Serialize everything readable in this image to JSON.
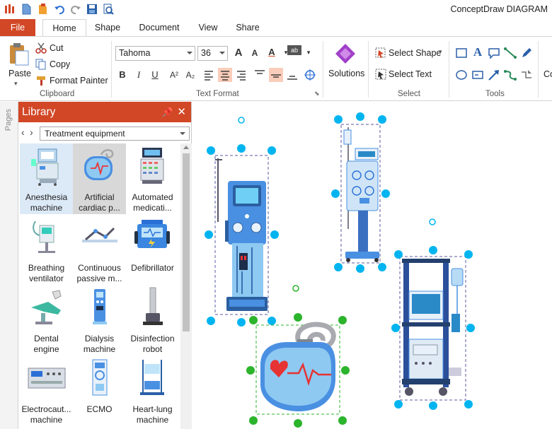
{
  "app": {
    "title": "ConceptDraw DIAGRAM"
  },
  "ribbon_tabs": [
    {
      "label": "File"
    },
    {
      "label": "Home"
    },
    {
      "label": "Shape"
    },
    {
      "label": "Document"
    },
    {
      "label": "View"
    },
    {
      "label": "Share"
    }
  ],
  "clipboard": {
    "paste": "Paste",
    "cut": "Cut",
    "copy": "Copy",
    "format_painter": "Format Painter",
    "group_label": "Clipboard"
  },
  "text_format": {
    "font": "Tahoma",
    "size": "36",
    "group_label": "Text Format"
  },
  "solutions": {
    "label": "Solutions"
  },
  "select": {
    "select_shape": "Select Shape",
    "select_text": "Select Text",
    "group_label": "Select"
  },
  "tools": {
    "group_label": "Tools",
    "cut_off": "Co"
  },
  "sidebar": {
    "pages_label": "Pages"
  },
  "library": {
    "title": "Library",
    "selected_library": "Treatment equipment",
    "items": [
      {
        "line1": "Anesthesia",
        "line2": "machine"
      },
      {
        "line1": "Artificial",
        "line2": "cardiac p..."
      },
      {
        "line1": "Automated",
        "line2": "medicati..."
      },
      {
        "line1": "Breathing",
        "line2": "ventilator"
      },
      {
        "line1": "Continuous",
        "line2": "passive m..."
      },
      {
        "line1": "Defibrillator",
        "line2": ""
      },
      {
        "line1": "Dental",
        "line2": "engine"
      },
      {
        "line1": "Dialysis",
        "line2": "machine"
      },
      {
        "line1": "Disinfection",
        "line2": "robot"
      },
      {
        "line1": "Electrocaut...",
        "line2": "machine"
      },
      {
        "line1": "ECMO",
        "line2": ""
      },
      {
        "line1": "Heart-lung",
        "line2": "machine"
      }
    ]
  },
  "colors": {
    "accent": "#d24726",
    "handle": "#00b4f0",
    "handle_selected": "#2cb42c",
    "device_blue": "#4a90e2",
    "device_light": "#8ec9f2"
  }
}
